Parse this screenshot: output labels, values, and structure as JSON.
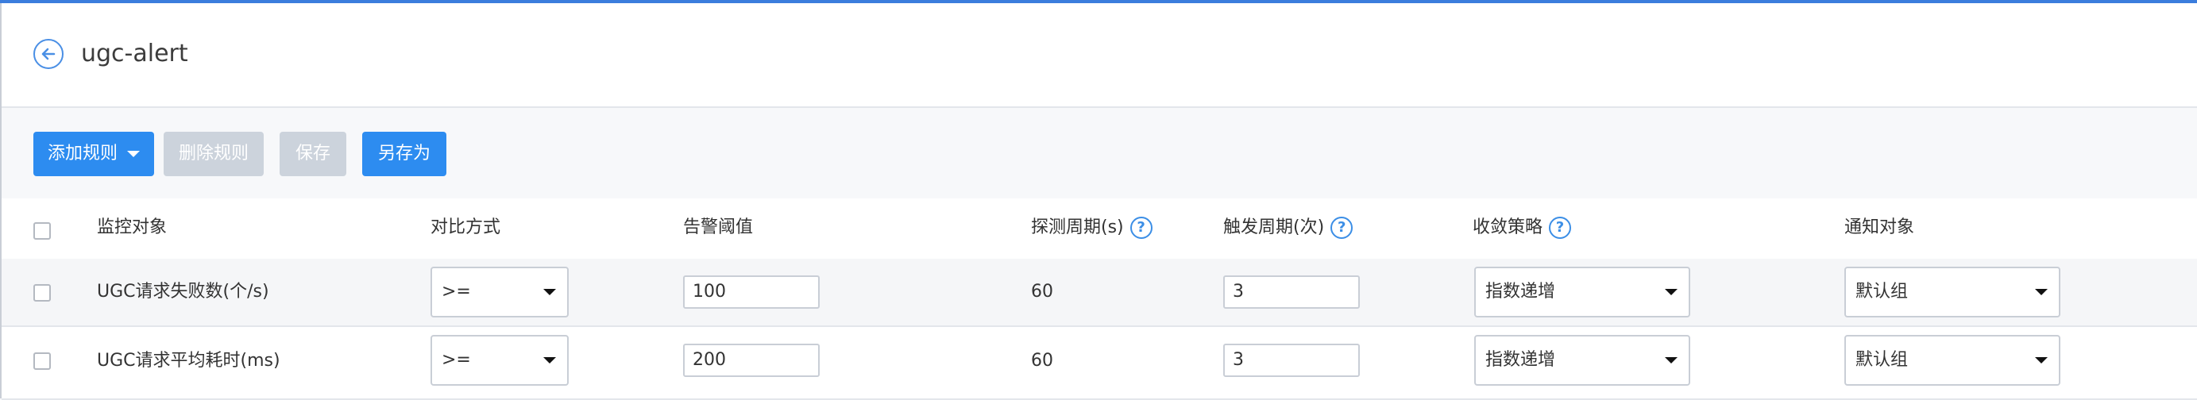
{
  "header": {
    "title": "ugc-alert"
  },
  "toolbar": {
    "add_rule": "添加规则",
    "delete_rule": "删除规则",
    "save": "保存",
    "save_as": "另存为"
  },
  "table": {
    "columns": {
      "target": "监控对象",
      "compare": "对比方式",
      "threshold": "告警阈值",
      "detect_period": "探测周期(s)",
      "trigger_period": "触发周期(次)",
      "convergence": "收敛策略",
      "notify": "通知对象"
    },
    "help_glyph": "?",
    "rows": [
      {
        "target": "UGC请求失败数(个/s)",
        "compare": ">=",
        "threshold": "100",
        "detect_period": "60",
        "trigger_period": "3",
        "convergence": "指数递增",
        "notify": "默认组"
      },
      {
        "target": "UGC请求平均耗时(ms)",
        "compare": ">=",
        "threshold": "200",
        "detect_period": "60",
        "trigger_period": "3",
        "convergence": "指数递增",
        "notify": "默认组"
      }
    ]
  }
}
